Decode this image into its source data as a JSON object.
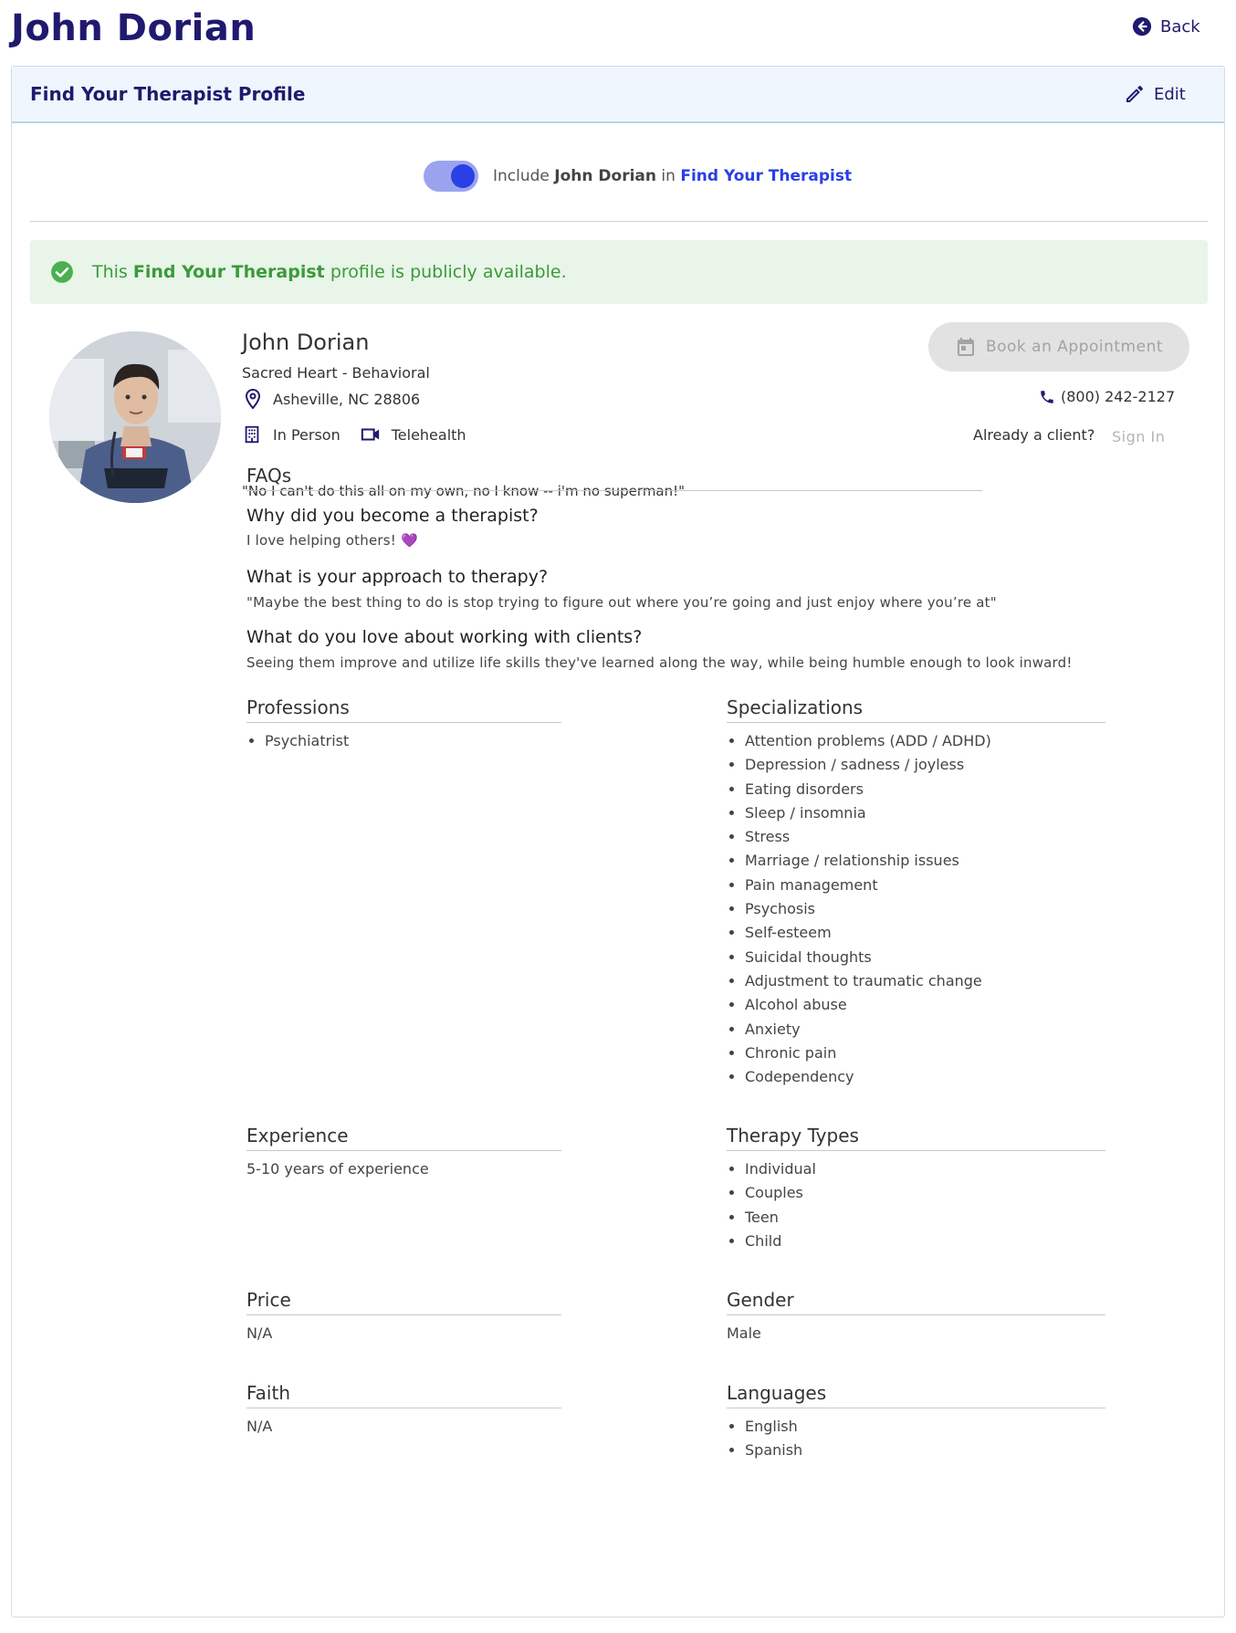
{
  "page": {
    "title": "John Dorian",
    "back_label": "Back"
  },
  "card": {
    "title": "Find Your Therapist Profile",
    "edit_label": "Edit"
  },
  "toggle": {
    "on": true,
    "prefix": "Include",
    "name": "John Dorian",
    "middle": "in",
    "link": "Find Your Therapist"
  },
  "alert": {
    "prefix": "This",
    "bold": "Find Your Therapist",
    "suffix": "profile is publicly available."
  },
  "profile": {
    "name": "John Dorian",
    "organization": "Sacred Heart - Behavioral",
    "location": "Asheville, NC 28806",
    "modes": [
      "In Person",
      "Telehealth"
    ],
    "quote": "\"No I can't do this all on my own, no I know -- i'm no superman!\"",
    "book_label": "Book an Appointment",
    "phone": "(800) 242-2127",
    "already_client": "Already a client?",
    "sign_in": "Sign In"
  },
  "faqs": {
    "title": "FAQs",
    "items": [
      {
        "q": "Why did you become a therapist?",
        "a": "I love helping others! 💜"
      },
      {
        "q": "What is your approach to therapy?",
        "a": "\"Maybe the best thing to do is stop trying to figure out where you’re going and just enjoy where you’re at\""
      },
      {
        "q": "What do you love about working with clients?",
        "a": "Seeing them improve and utilize life skills they've learned along the way, while being humble enough to look inward!"
      }
    ]
  },
  "professions": {
    "title": "Professions",
    "items": [
      "Psychiatrist"
    ]
  },
  "specializations": {
    "title": "Specializations",
    "items": [
      "Attention problems (ADD / ADHD)",
      "Depression / sadness / joyless",
      "Eating disorders",
      "Sleep / insomnia",
      "Stress",
      "Marriage / relationship issues",
      "Pain management",
      "Psychosis",
      "Self-esteem",
      "Suicidal thoughts",
      "Adjustment to traumatic change",
      "Alcohol abuse",
      "Anxiety",
      "Chronic pain",
      "Codependency"
    ]
  },
  "experience": {
    "title": "Experience",
    "value": "5-10 years of experience"
  },
  "therapy_types": {
    "title": "Therapy Types",
    "items": [
      "Individual",
      "Couples",
      "Teen",
      "Child"
    ]
  },
  "price": {
    "title": "Price",
    "value": "N/A"
  },
  "gender": {
    "title": "Gender",
    "value": "Male"
  },
  "faith": {
    "title": "Faith",
    "value": "N/A"
  },
  "languages": {
    "title": "Languages",
    "items": [
      "English",
      "Spanish"
    ]
  },
  "colors": {
    "brand": "#1f1a6e",
    "accent": "#2a3fe6",
    "success": "#3b9a3b"
  },
  "icons": {
    "back": "arrow-left-circle-icon",
    "edit": "pencil-icon",
    "check": "check-circle-icon",
    "location": "map-pin-icon",
    "in_person": "building-icon",
    "telehealth": "video-camera-icon",
    "calendar": "calendar-icon",
    "phone": "phone-icon"
  }
}
